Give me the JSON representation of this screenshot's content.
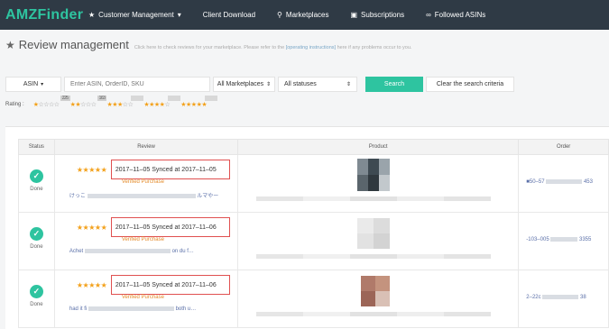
{
  "nav": {
    "logo": "AMZFinder",
    "items": [
      {
        "label": "Customer Management",
        "icon": "star-icon",
        "dropdown": true
      },
      {
        "label": "Client Download",
        "icon": "",
        "dropdown": false
      },
      {
        "label": "Marketplaces",
        "icon": "sitemap-icon",
        "dropdown": false
      },
      {
        "label": "Subscriptions",
        "icon": "cart-icon",
        "dropdown": false
      },
      {
        "label": "Followed ASINs",
        "icon": "link-icon",
        "dropdown": false
      }
    ]
  },
  "page": {
    "title": "Review management",
    "hint_prefix": "Click here to check reviews for your marketplace. Please refer to the",
    "hint_link": "[operating instructions]",
    "hint_suffix": "here if any problems occur to you."
  },
  "filters": {
    "asin_select": "ASIN",
    "search_placeholder": "Enter ASIN, OrderID, SKU",
    "marketplace_select": "All Marketplaces",
    "status_select": "All statuses",
    "search_button": "Search",
    "clear_button": "Clear the search criteria"
  },
  "rating": {
    "label": "Rating :",
    "levels": [
      {
        "stars": 1,
        "count": "225"
      },
      {
        "stars": 2,
        "count": "163"
      },
      {
        "stars": 3,
        "count": ""
      },
      {
        "stars": 4,
        "count": ""
      },
      {
        "stars": 5,
        "count": ""
      }
    ]
  },
  "table": {
    "headers": {
      "status": "Status",
      "review": "Review",
      "product": "Product",
      "order": "Order"
    },
    "rows": [
      {
        "status": "Done",
        "stars": "★★★★★",
        "sync": "2017–11–05 Synced at 2017–11–05",
        "verified": "Verified Purchase",
        "snippet_start": "けっこ",
        "snippet_end": "ルマやー",
        "order_start": "■50–57",
        "order_end": "453"
      },
      {
        "status": "Done",
        "stars": "★★★★★",
        "sync": "2017–11–05 Synced at 2017–11–06",
        "verified": "Verified Purchase",
        "snippet_start": "Achet",
        "snippet_end": "on du f…",
        "order_start": "-103–005",
        "order_end": "3355"
      },
      {
        "status": "Done",
        "stars": "★★★★★",
        "sync": "2017–11–05 Synced at 2017–11–06",
        "verified": "Verified Purchase",
        "snippet_start": "had it fi",
        "snippet_end": "both u…",
        "order_start": "2–22c",
        "order_end": "38"
      }
    ]
  },
  "colors": {
    "accent": "#2ec4a0",
    "nav_bg": "#2f3a45",
    "star": "#f3a11b",
    "highlight_box": "#e05050"
  }
}
